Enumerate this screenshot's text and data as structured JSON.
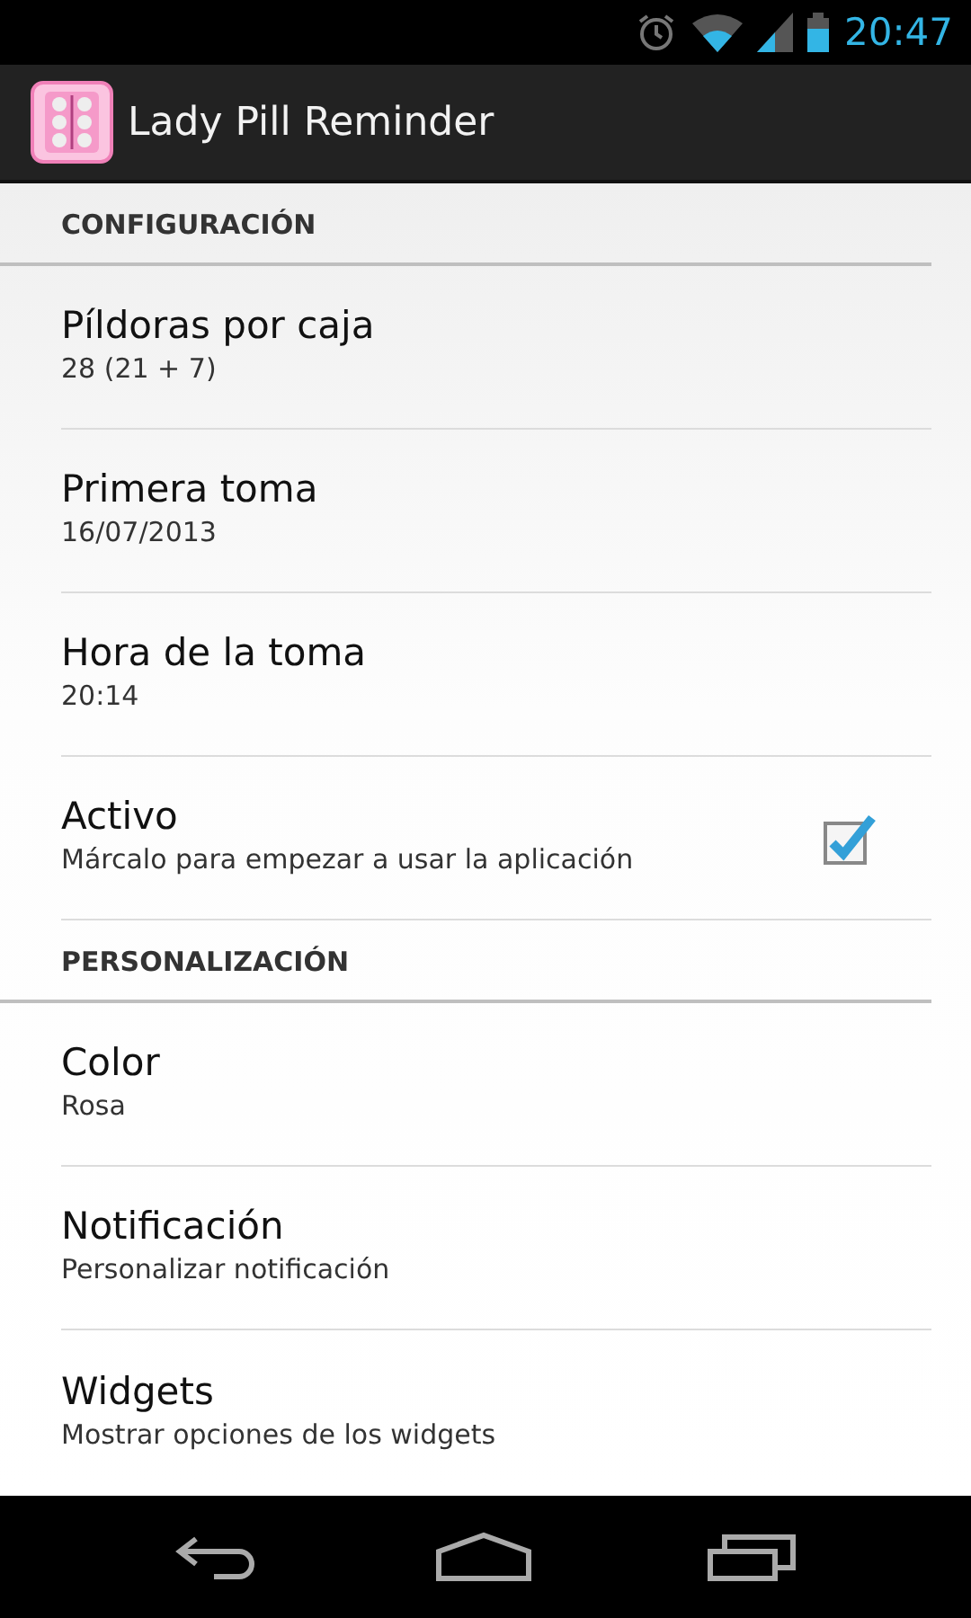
{
  "status_bar": {
    "time": "20:47"
  },
  "app_bar": {
    "title": "Lady Pill Reminder"
  },
  "sections": [
    {
      "header": "CONFIGURACIÓN",
      "items": [
        {
          "kind": "text",
          "title": "Píldoras por caja",
          "summary": "28 (21 + 7)"
        },
        {
          "kind": "text",
          "title": "Primera toma",
          "summary": "16/07/2013"
        },
        {
          "kind": "text",
          "title": "Hora de la toma",
          "summary": "20:14"
        },
        {
          "kind": "checkbox",
          "title": "Activo",
          "summary": "Márcalo para empezar a usar la aplicación",
          "checked": true
        }
      ]
    },
    {
      "header": "PERSONALIZACIÓN",
      "items": [
        {
          "kind": "text",
          "title": "Color",
          "summary": "Rosa"
        },
        {
          "kind": "text",
          "title": "Notificación",
          "summary": "Personalizar notificación"
        },
        {
          "kind": "text",
          "title": "Widgets",
          "summary": "Mostrar opciones de los widgets"
        }
      ]
    }
  ]
}
